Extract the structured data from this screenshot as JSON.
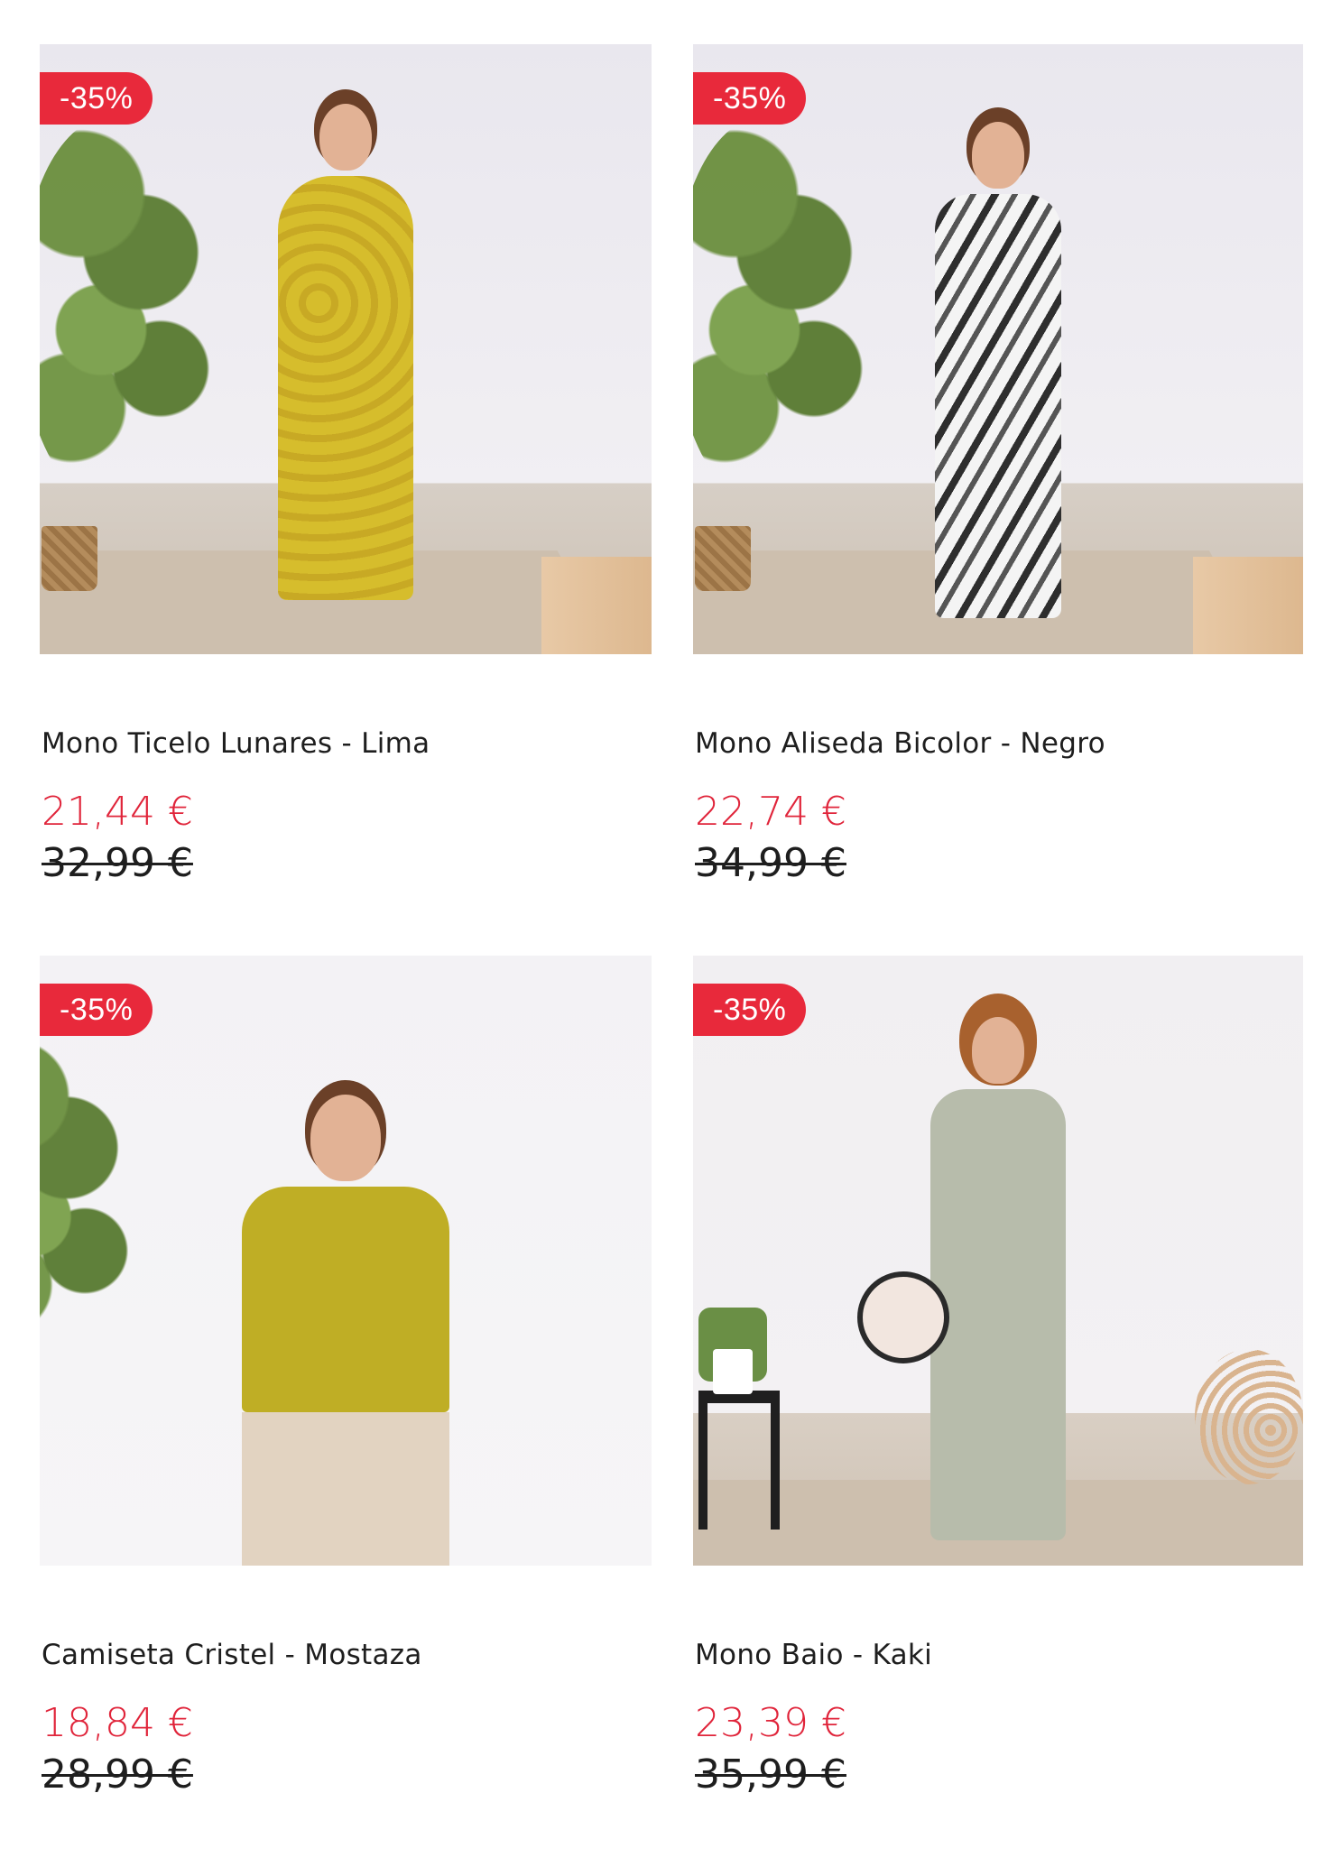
{
  "colors": {
    "discount_bg": "#e8293b",
    "price": "#e0243a",
    "old_price": "#1e1e1e"
  },
  "products": [
    {
      "name": "Mono Ticelo Lunares - Lima",
      "discount": "-35%",
      "price": "21,44 €",
      "old_price": "32,99 €",
      "garment_color": "#d2b82a"
    },
    {
      "name": "Mono Aliseda Bicolor - Negro",
      "discount": "-35%",
      "price": "22,74 €",
      "old_price": "34,99 €",
      "garment_color": "#3a3a3a"
    },
    {
      "name": "Camiseta Cristel - Mostaza",
      "discount": "-35%",
      "price": "18,84 €",
      "old_price": "28,99 €",
      "garment_color": "#bfae25"
    },
    {
      "name": "Mono Baio - Kaki",
      "discount": "-35%",
      "price": "23,39 €",
      "old_price": "35,99 €",
      "garment_color": "#b7bcab"
    }
  ]
}
